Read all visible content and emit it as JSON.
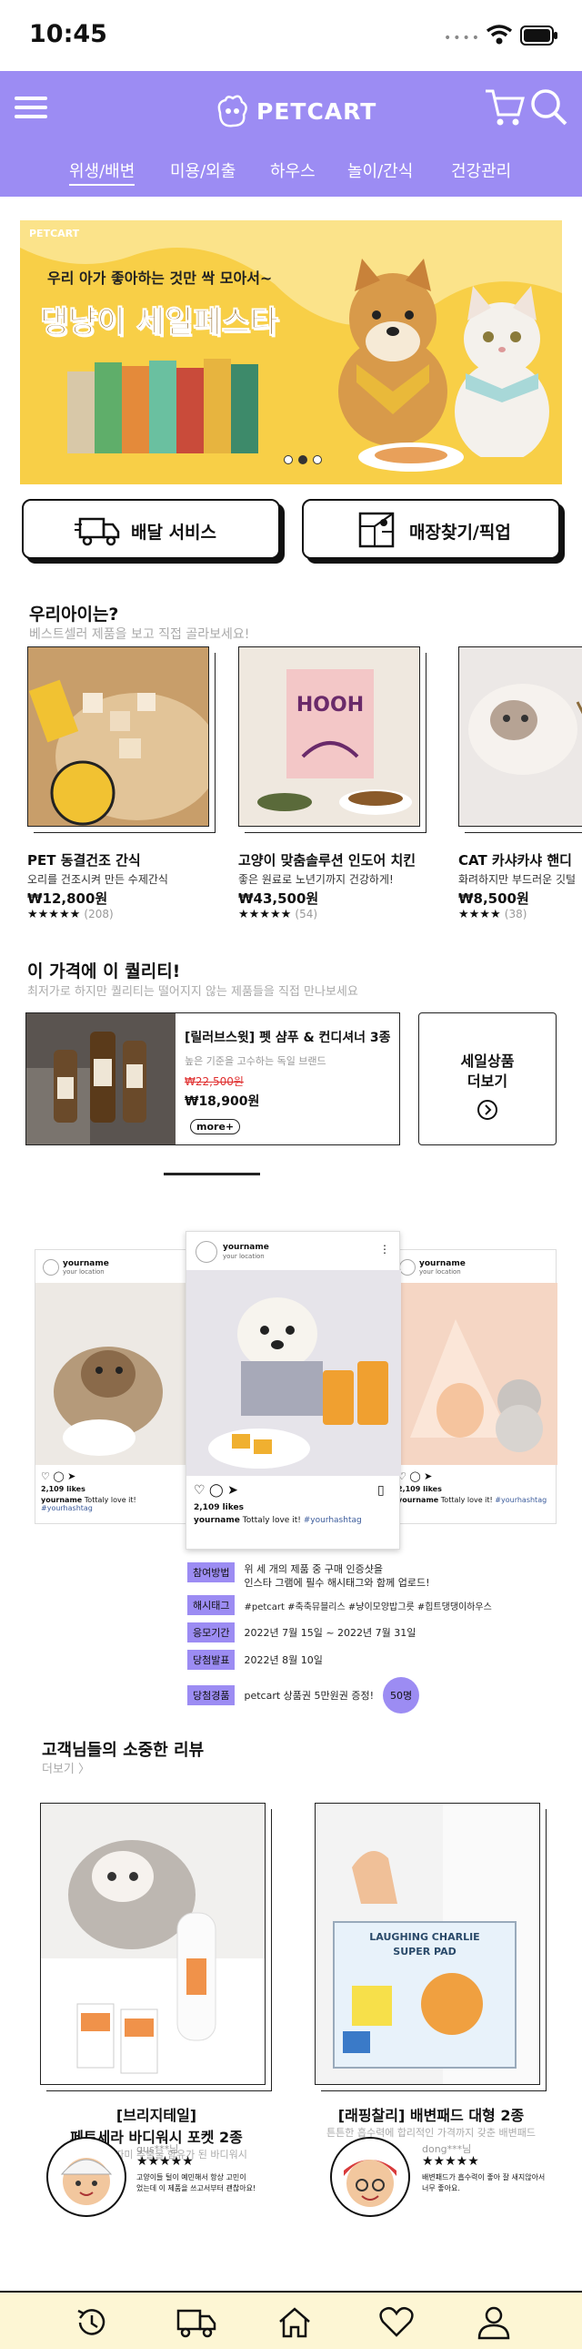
{
  "status": {
    "time": "10:45"
  },
  "header": {
    "logo": "PETCART",
    "nav": [
      "위생/배변",
      "미용/외출",
      "하우스",
      "놀이/간식",
      "건강관리"
    ]
  },
  "banner": {
    "brand": "PETCART",
    "tagline": "우리 아가 좋아하는 것만 싹 모아서~",
    "title": "댕냥이 세일페스타"
  },
  "service_buttons": {
    "delivery": "배달 서비스",
    "pickup": "매장찾기/픽업"
  },
  "recommend": {
    "title": "우리아이는?",
    "subtitle": "베스트셀러 제품을 보고 직접 골라보세요!",
    "products": [
      {
        "name": "PET 동결건조 간식",
        "desc": "오리를 건조시켜 만든 수제간식",
        "price": "₩12,800원",
        "stars": "★★★★★",
        "count": "(208)"
      },
      {
        "name": "고양이 맞춤솔루션 인도어 치킨",
        "desc": "좋은 원료로 노년기까지 건강하게!",
        "price": "₩43,500원",
        "stars": "★★★★★",
        "count": "(54)"
      },
      {
        "name": "CAT 카샤카샤 핸디",
        "desc": "화려하지만 부드러운 깃털",
        "price": "₩8,500원",
        "stars": "★★★★",
        "count": "(38)"
      }
    ]
  },
  "quality": {
    "title": "이 가격에 이 퀄리티!",
    "subtitle": "최저가로 하지만 퀄리티는 떨어지지 않는 제품들을 직접 만나보세요",
    "product_name": "[릴러브스윗] 펫 샴푸 & 컨디셔너 3종",
    "product_desc": "높은 기준을 고수하는 독일 브랜드",
    "old_price": "₩22,500원",
    "price": "₩18,900원",
    "more": "more+",
    "sale_more": "세일상품\n더보기"
  },
  "instagram": {
    "cards": [
      {
        "user": "yourname",
        "loc": "your location",
        "likes": "2,109 likes",
        "caption_user": "yourname",
        "caption": "Tottaly love it!",
        "hashtag": "#yourhashtag"
      },
      {
        "user": "yourname",
        "loc": "your location",
        "likes": "2,109 likes",
        "caption_user": "yourname",
        "caption": "Tottaly love it!",
        "hashtag": "#yourhashtag"
      },
      {
        "user": "yourname",
        "loc": "your location",
        "likes": "2,109 likes",
        "caption_user": "yourname",
        "caption": "Tottaly love it!",
        "hashtag": "#yourhashtag"
      }
    ]
  },
  "event": [
    {
      "label": "참여방법",
      "text": "위 세 개의 제품 중 구매 인증샷을\n인스타 그램에 필수 해시태그와 함께 업로드!"
    },
    {
      "label": "해시태그",
      "text": "#petcart #축축뮤블리스 #냥이모양밥그릇 #힙트댕댕이하우스"
    },
    {
      "label": "응모기간",
      "text": "2022년 7월 15일 ~ 2022년 7월 31일"
    },
    {
      "label": "당첨발표",
      "text": "2022년 8월 10일"
    },
    {
      "label": "당첨경품",
      "text": "petcart 상품권 5만원권 증정!",
      "badge": "50명"
    }
  ],
  "reviews": {
    "title": "고객님들의 소중한 리뷰",
    "more": "더보기 〉",
    "items": [
      {
        "name": "[브리지테일]\n페토세라 바디워시 포켓 2종",
        "sub": "캣닢과 아마따미 추출물 함유가 된 바디워시",
        "reviewer": "gus***님",
        "stars": "★★★★★",
        "text": "고양이들 털이 예민해서 항상 고민이\n었는데 이 제품을 쓰고서부터 괜찮아요!"
      },
      {
        "name": "[래핑찰리] 배변패드 대형 2종",
        "sub": "튼튼한 흡수력에 합리적인 가격까지 갖춘 배변패드",
        "reviewer": "dong***님",
        "stars": "★★★★★",
        "text": "배변패드가 흡수력이 좋아 잘 새지않아서\n너무 좋아요."
      }
    ]
  },
  "colors": {
    "accent": "#9c8cf3",
    "banner": "#f8cf47",
    "tabbar": "#fdf6d4"
  }
}
